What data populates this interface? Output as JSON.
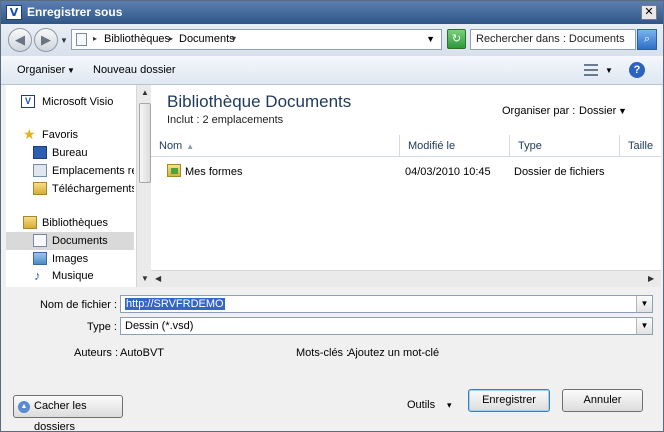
{
  "window": {
    "title": "Enregistrer sous",
    "app_icon_letter": "V",
    "close_glyph": "✕"
  },
  "address": {
    "crumbs": [
      "Bibliothèques",
      "Documents"
    ],
    "search_placeholder": "Rechercher dans : Documents"
  },
  "toolbar": {
    "organize_label": "Organiser",
    "new_folder_label": "Nouveau dossier",
    "help_glyph": "?"
  },
  "nav": {
    "items": [
      {
        "label": "Microsoft Visio",
        "icon": "visio-icon"
      },
      {
        "label": "Favoris",
        "icon": "star-icon"
      },
      {
        "label": "Bureau",
        "icon": "desktop-icon"
      },
      {
        "label": "Emplacements réce",
        "icon": "recent-places-icon"
      },
      {
        "label": "Téléchargements",
        "icon": "downloads-icon"
      },
      {
        "label": "Bibliothèques",
        "icon": "libraries-icon"
      },
      {
        "label": "Documents",
        "icon": "documents-icon",
        "selected": true
      },
      {
        "label": "Images",
        "icon": "pictures-icon"
      },
      {
        "label": "Musique",
        "icon": "music-icon"
      }
    ]
  },
  "library": {
    "title": "Bibliothèque Documents",
    "subtitle": "Inclut :  2 emplacements",
    "arrange_label": "Organiser par :",
    "arrange_value": "Dossier"
  },
  "columns": {
    "name": "Nom",
    "modified": "Modifié le",
    "type": "Type",
    "size": "Taille"
  },
  "files": [
    {
      "name": "Mes formes",
      "modified": "04/03/2010 10:45",
      "type": "Dossier de fichiers"
    }
  ],
  "form": {
    "filename_label": "Nom de fichier :",
    "filename_value": "http://SRVFRDEMO",
    "type_label": "Type :",
    "type_value": "Dessin (*.vsd)",
    "authors_label": "Auteurs :",
    "authors_value": "AutoBVT",
    "keywords_label": "Mots-clés :",
    "keywords_value": "Ajoutez un mot-clé"
  },
  "buttons": {
    "hide_folders": "Cacher les dossiers",
    "tools": "Outils",
    "save": "Enregistrer",
    "cancel": "Annuler"
  }
}
